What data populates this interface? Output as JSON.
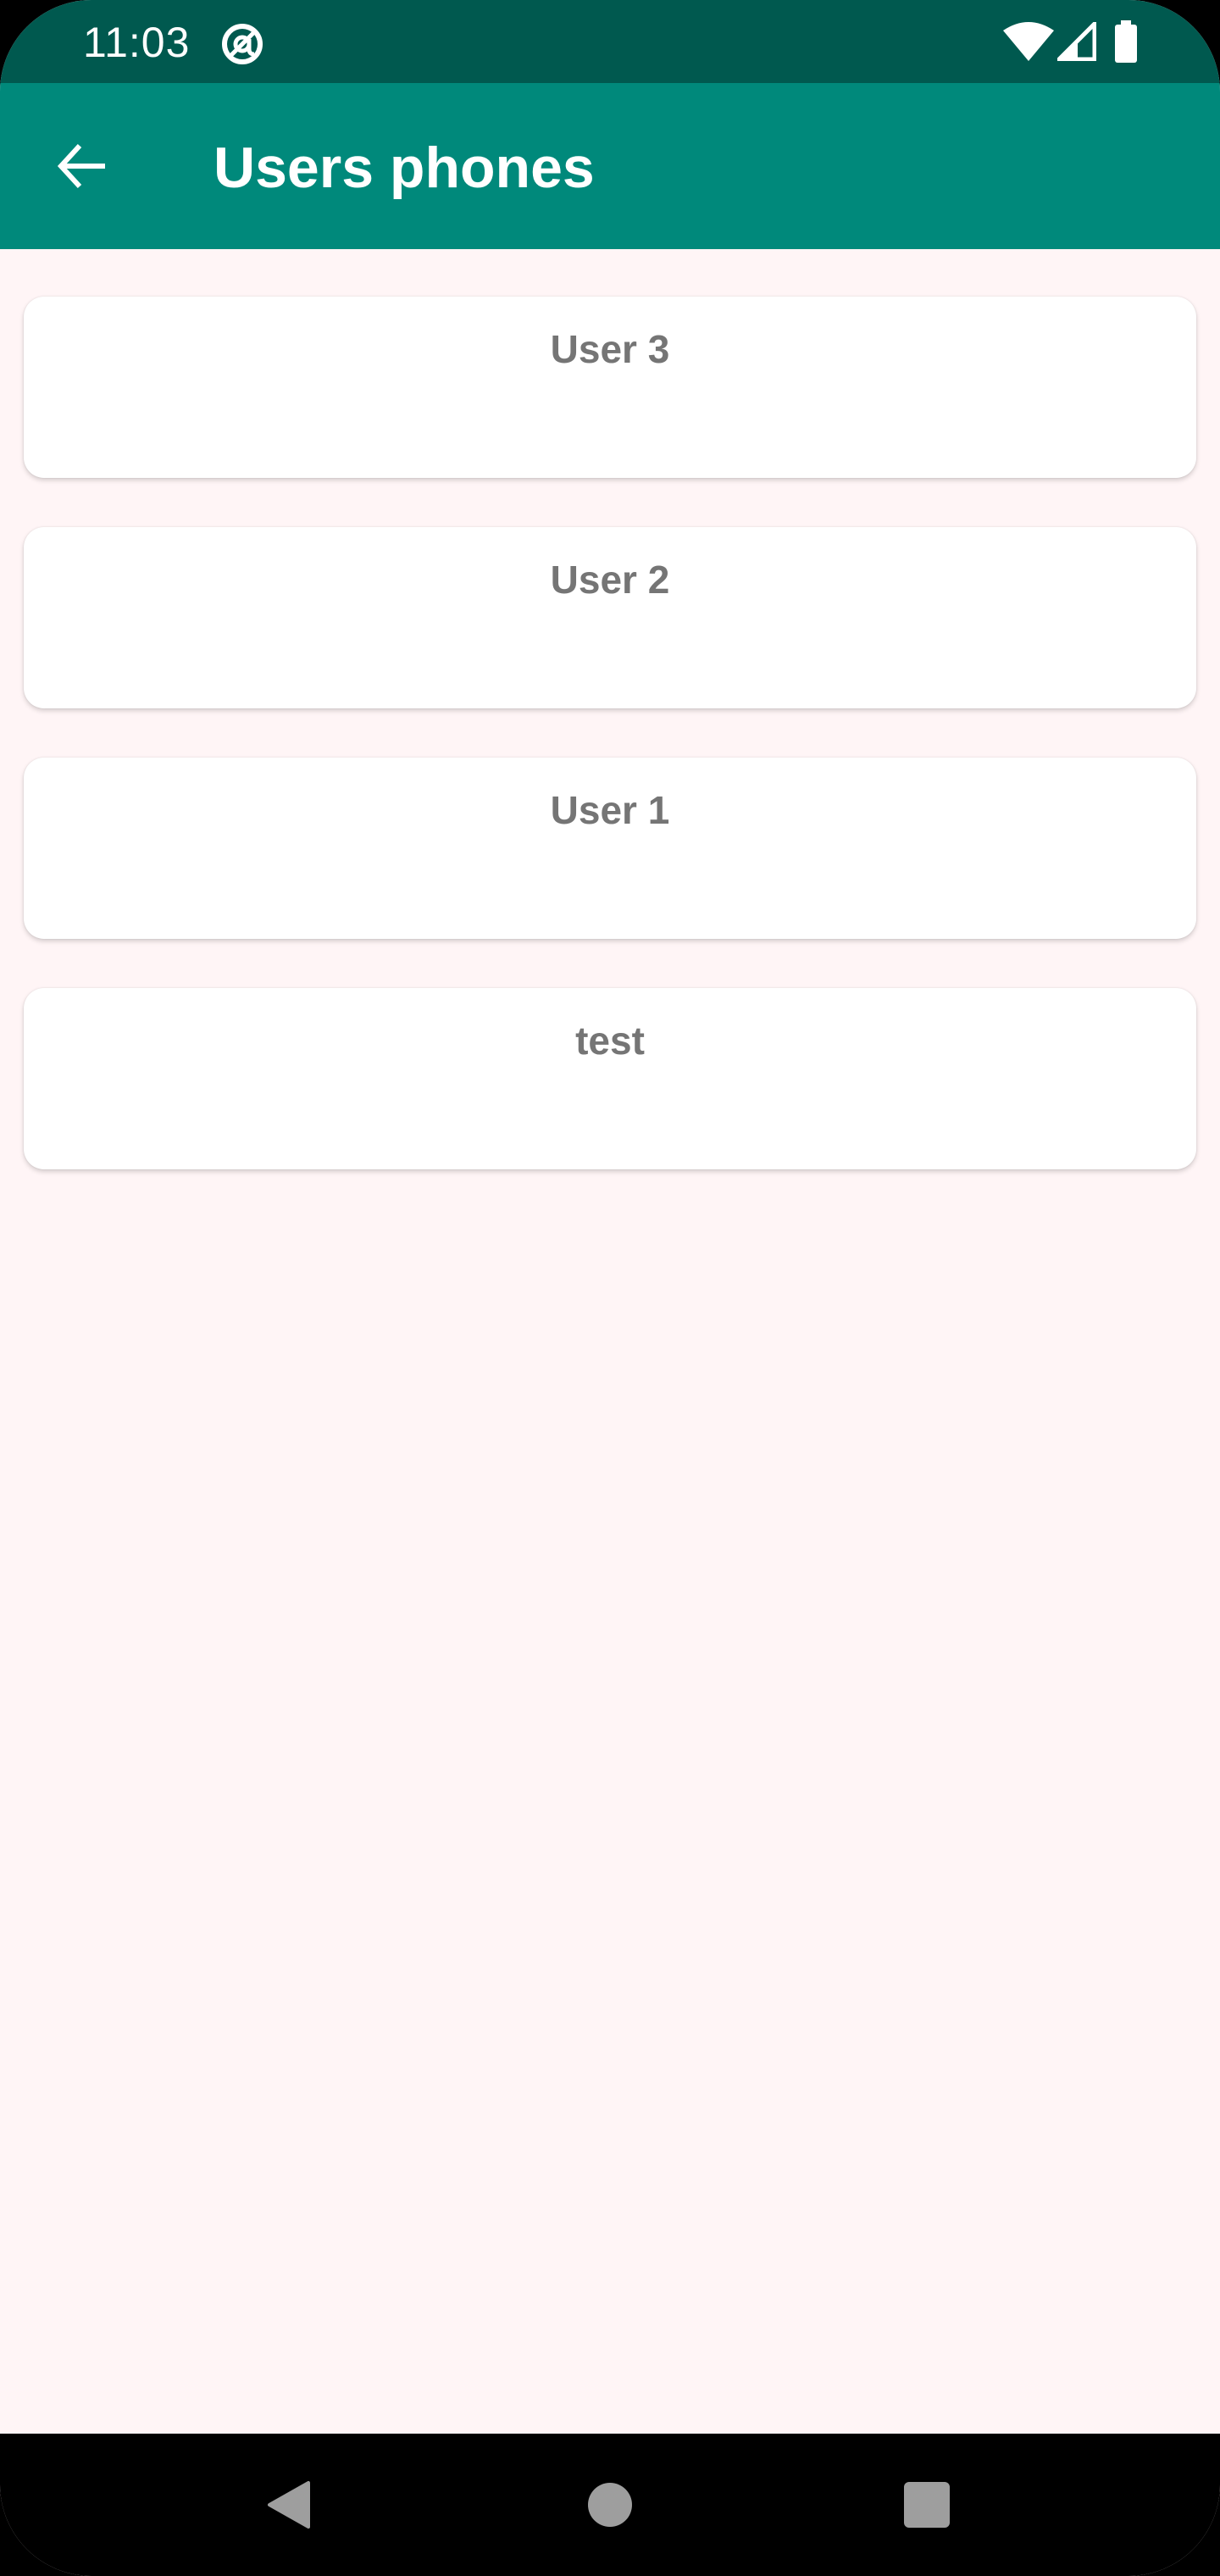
{
  "status_bar": {
    "time": "11:03",
    "icons": [
      "at-sign-icon",
      "wifi-icon",
      "signal-icon",
      "battery-icon"
    ]
  },
  "app_bar": {
    "back_icon": "arrow-left-icon",
    "title": "Users phones"
  },
  "users": [
    {
      "name": "User 3"
    },
    {
      "name": "User 2"
    },
    {
      "name": "User 1"
    },
    {
      "name": "test"
    }
  ],
  "nav_bar": {
    "icons": [
      "nav-back-icon",
      "nav-home-icon",
      "nav-recents-icon"
    ]
  },
  "colors": {
    "status_bar": "#00594F",
    "app_bar": "#00897B",
    "background": "#FFF5F6",
    "card": "#FFFFFF",
    "card_text": "#757575"
  }
}
